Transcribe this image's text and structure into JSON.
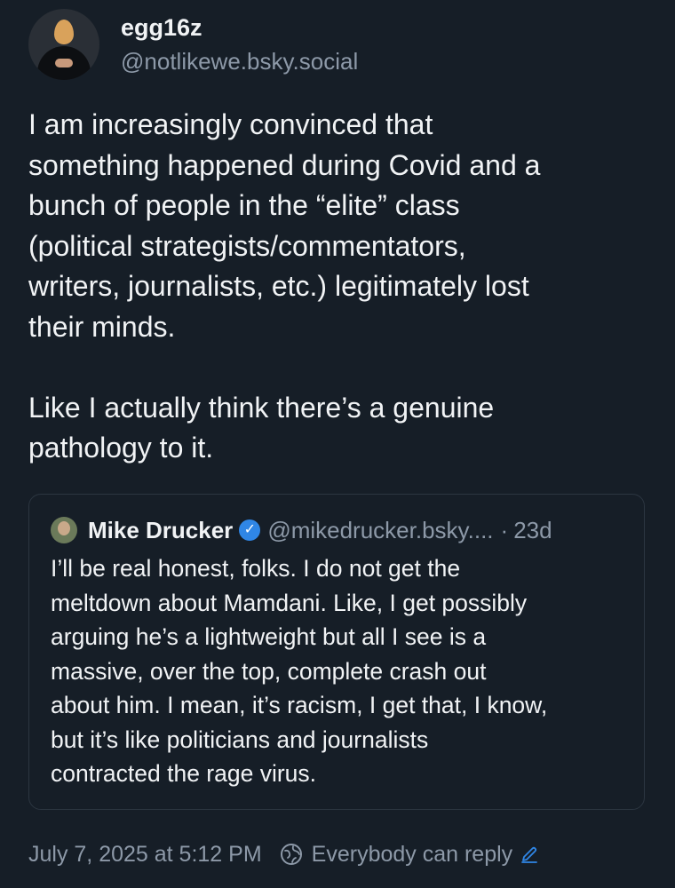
{
  "author": {
    "display_name": "egg16z",
    "handle": "@notlikewe.bsky.social",
    "avatar_icon": "avatar-egg-head-icon"
  },
  "post": {
    "paragraphs": [
      "I am increasingly convinced that\nsomething happened during Covid and a\nbunch of people in the “elite” class\n(political strategists/commentators,\nwriters, journalists, etc.) legitimately lost\ntheir minds.",
      "Like I actually think there’s a genuine\npathology to it."
    ]
  },
  "quote": {
    "name": "Mike Drucker",
    "handle": "@mikedrucker.bsky....",
    "separator": "·",
    "time": "23d",
    "text": "I’ll be real honest, folks. I do not get the\nmeltdown about Mamdani. Like, I get possibly\narguing he’s a lightweight but all I see is a\nmassive, over the top, complete crash out\nabout him. I mean, it’s racism, I get that, I know,\nbut it’s like politicians and journalists\ncontracted the rage virus.",
    "verified_color": "#2f86e6"
  },
  "footer": {
    "timestamp": "July 7, 2025 at 5:12 PM",
    "reply_setting": "Everybody can reply",
    "accent_color": "#2f86e6"
  },
  "colors": {
    "background": "#161e27",
    "text": "#f1f3f5",
    "muted": "#8d99a8"
  }
}
